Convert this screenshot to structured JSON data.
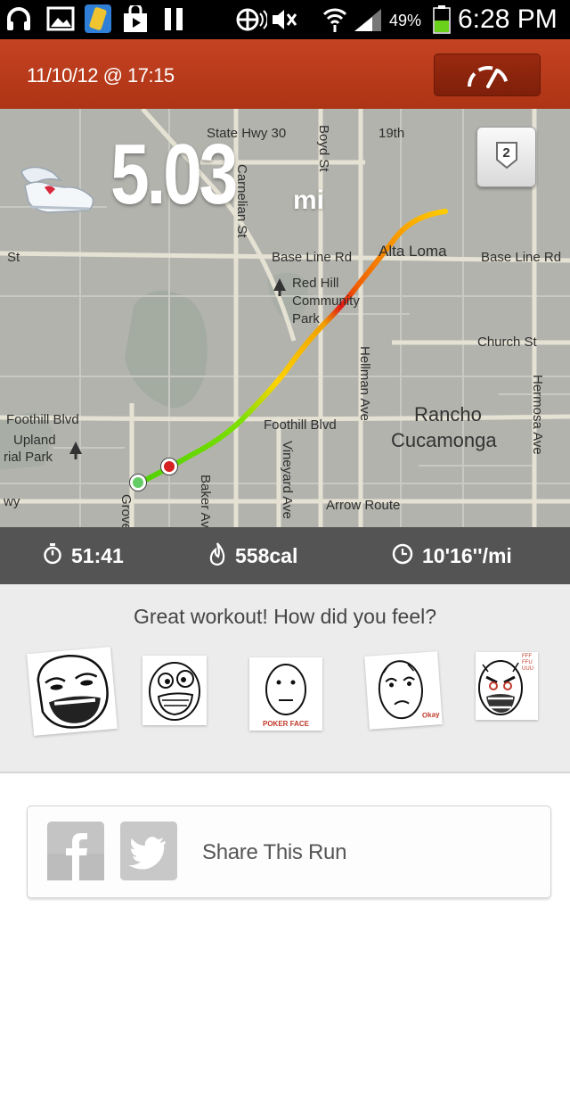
{
  "status_bar": {
    "battery_percent": "49%",
    "time": "6:28 PM",
    "icons": [
      "headphones-icon",
      "gallery-icon",
      "notes-icon",
      "shopping-bag-icon",
      "pause-icon",
      "nfc-icon",
      "mute-icon",
      "wifi-icon",
      "signal-icon",
      "battery-icon"
    ]
  },
  "header": {
    "date_time": "11/10/12 @ 17:15",
    "speed_icon": "gauge-icon"
  },
  "map": {
    "distance_value": "5.03",
    "distance_unit": "mi",
    "badge_number": "2",
    "labels": {
      "state_hwy": "State Hwy 30",
      "boyd": "Boyd St",
      "nineteenth": "19th",
      "carnelian": "Carnelian St",
      "base_line_left": "Base Line Rd",
      "alta_loma": "Alta Loma",
      "base_line_right": "Base Line Rd",
      "red_hill_1": "Red Hill",
      "red_hill_2": "Community",
      "red_hill_3": "Park",
      "church": "Church St",
      "hellman": "Hellman Ave",
      "hermosa": "Hermosa Ave",
      "st_left": "St",
      "foothill_left": "Foothill Blvd",
      "foothill_mid": "Foothill Blvd",
      "upland_1": "Upland",
      "upland_2": "rial Park",
      "rancho": "Rancho",
      "cucamonga": "Cucamonga",
      "vineyard": "Vineyard Ave",
      "baker": "Baker Ave",
      "grove": "Grove",
      "arrow": "Arrow Route",
      "wy": "wy"
    }
  },
  "stats": {
    "duration": "51:41",
    "calories": "558cal",
    "pace": "10'16''/mi"
  },
  "feel": {
    "title": "Great workout! How did you feel?",
    "faces": [
      {
        "name": "sweet-jesus-face",
        "caption": ""
      },
      {
        "name": "excited-face",
        "caption": ""
      },
      {
        "name": "poker-face",
        "caption": "POKER FACE"
      },
      {
        "name": "okay-face",
        "caption": "Okay"
      },
      {
        "name": "rage-face",
        "caption": "FFFFFUUUU"
      }
    ]
  },
  "share": {
    "label": "Share This Run"
  },
  "colors": {
    "header_red": "#b8391a",
    "stats_gray": "#545454",
    "route_green": "#5fd000",
    "route_yellow": "#ffd000",
    "route_red": "#e01818"
  }
}
